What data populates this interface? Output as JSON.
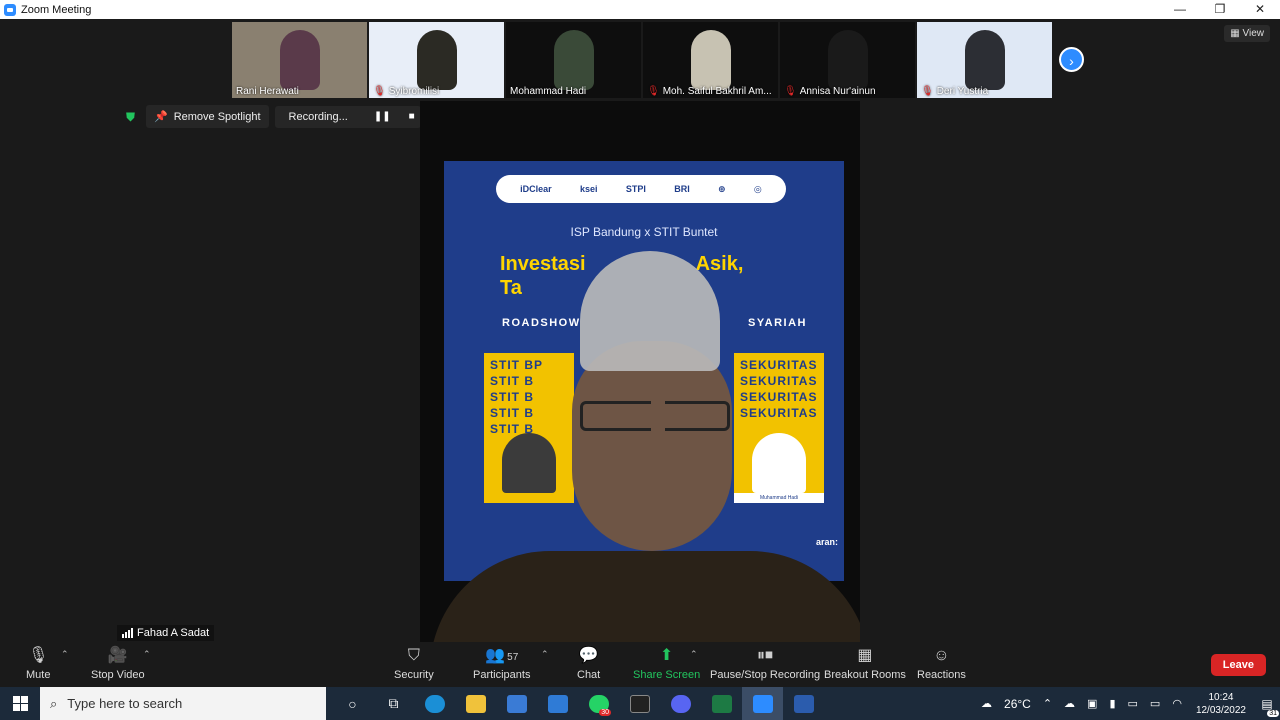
{
  "window": {
    "title": "Zoom Meeting",
    "minimize": "—",
    "restore": "❐",
    "close": "✕"
  },
  "thumbnails": [
    {
      "name": "Rani Herawati",
      "muted": false,
      "bg": "#8a8070",
      "face": "#5a3a4a"
    },
    {
      "name": "Syibromilisi",
      "muted": true,
      "bg": "#e8eef8",
      "face": "#2b2a24"
    },
    {
      "name": "Mohammad Hadi",
      "muted": false,
      "bg": "#0e0e0e",
      "face": "#3a4a38"
    },
    {
      "name": "Moh. Saiful Bakhril Am...",
      "muted": true,
      "bg": "#0e0e0e",
      "face": "#c7c2b2"
    },
    {
      "name": "Annisa Nur'ainun",
      "muted": true,
      "bg": "#0e0e0e",
      "face": "#1a1a1a"
    },
    {
      "name": "Deri Yustria",
      "muted": true,
      "bg": "#dfe8f5",
      "face": "#2c2e34"
    }
  ],
  "view_label": "View",
  "spotlight": {
    "remove_label": "Remove Spotlight",
    "recording_label": "Recording...",
    "pause": "❚❚",
    "stop": "■"
  },
  "poster": {
    "logos": [
      "iDClear",
      "ksei",
      "STPI",
      "BRI",
      "⊕",
      "◎"
    ],
    "subtitle": "ISP Bandung x STIT Buntet",
    "headline_1": "Investasi",
    "headline_1b": "Asik,",
    "headline_2": "Ta",
    "road_left": "ROADSHOW",
    "road_right": "SYARIAH",
    "card_left_title": "STIT BP STIT B STIT B STIT B STIT B",
    "card_right_title": "SEKURITAS SEKURITAS SEKURITAS SEKURITAS",
    "card_right_name": "Muhammad Hadi",
    "pay_text": "aran:"
  },
  "self_view": {
    "name": "Fahad A Sadat"
  },
  "toolbar": {
    "mute": "Mute",
    "stop_video": "Stop Video",
    "security": "Security",
    "participants": "Participants",
    "participants_count": "57",
    "chat": "Chat",
    "share_screen": "Share Screen",
    "pause_stop_recording": "Pause/Stop Recording",
    "breakout_rooms": "Breakout Rooms",
    "reactions": "Reactions",
    "leave": "Leave"
  },
  "taskbar": {
    "search_placeholder": "Type here to search",
    "whatsapp_badge": "30",
    "temperature": "26°C",
    "time": "10:24",
    "date": "12/03/2022",
    "notif_count": "31"
  }
}
